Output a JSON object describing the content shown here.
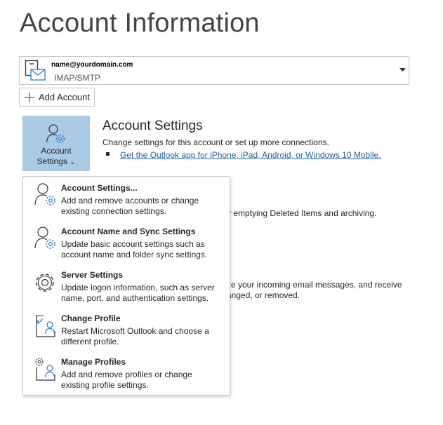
{
  "page": {
    "title": "Account Information"
  },
  "account": {
    "email": "name@yourdomain.com",
    "type": "IMAP/SMTP"
  },
  "add_account": {
    "label": "Add Account"
  },
  "account_settings_button": {
    "line1": "Account",
    "line2": "Settings",
    "chevron": "⌄"
  },
  "section": {
    "title": "Account Settings",
    "description": "Change settings for this account or set up more connections.",
    "link": "Get the Outlook app for iPhone, iPad, Android, or Windows 10 Mobile."
  },
  "background_text": {
    "mailbox": "y emptying Deleted Items and archiving.",
    "rules_line1": "ze your incoming email messages, and receive",
    "rules_line2": "anged, or removed."
  },
  "menu": {
    "items": [
      {
        "title": "Account Settings...",
        "desc1": "Add and remove accounts or change",
        "desc2": "existing connection settings.",
        "icon": "account-settings-icon"
      },
      {
        "title": "Account Name and Sync Settings",
        "desc1": "Update basic account settings such as",
        "desc2": "account name and folder sync settings.",
        "icon": "account-name-sync-icon"
      },
      {
        "title": "Server Settings",
        "desc1": "Update logon information, such as server",
        "desc2": "name, port, and authentication settings.",
        "icon": "server-settings-gear-icon"
      },
      {
        "title": "Change Profile",
        "desc1": "Restart Microsoft Outlook and choose a",
        "desc2": "different profile.",
        "icon": "change-profile-icon"
      },
      {
        "title": "Manage Profiles",
        "desc1": "Add and remove profiles or change",
        "desc2": "existing profile settings.",
        "icon": "manage-profiles-icon"
      }
    ]
  },
  "colors": {
    "button_highlight": "#a9cbe6",
    "link": "#1f5fa8",
    "accent_icon": "#2b7cd3",
    "add_green": "#3a9a3a"
  }
}
